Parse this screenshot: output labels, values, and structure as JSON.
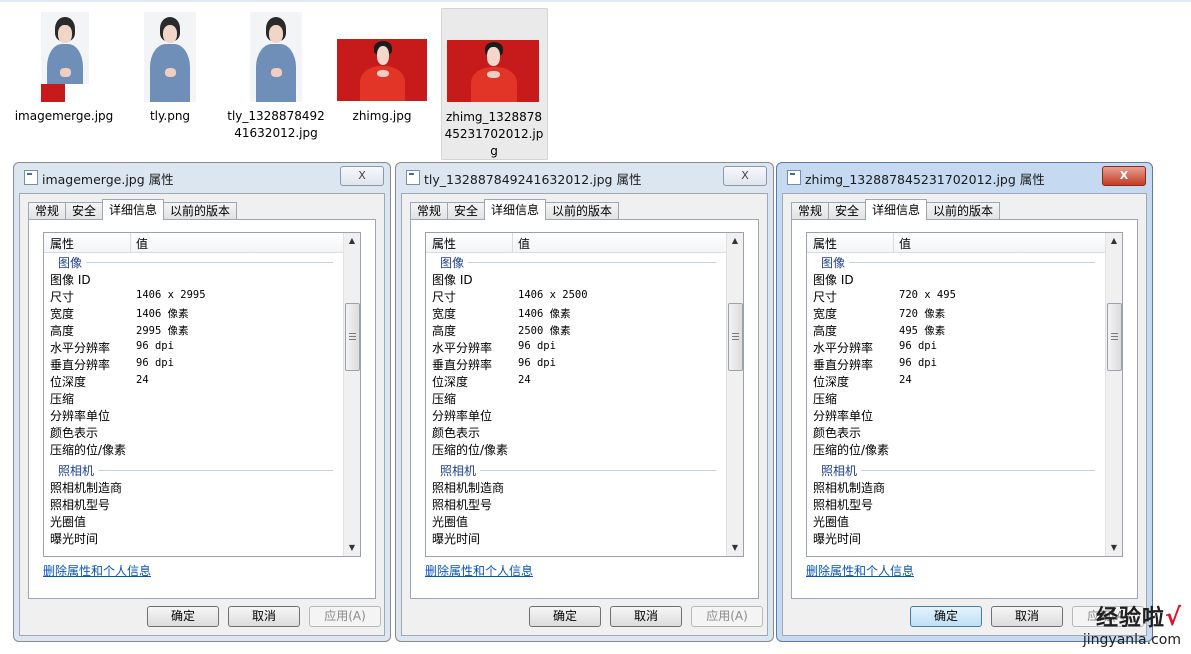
{
  "files": [
    {
      "name": "imagemerge.jpg",
      "kind": "portrait-merged"
    },
    {
      "name": "tly.png",
      "kind": "portrait"
    },
    {
      "name": "tly_132887849241632012.jpg",
      "kind": "portrait"
    },
    {
      "name": "zhimg.jpg",
      "kind": "red"
    },
    {
      "name": "zhimg_132887845231702012.jpg",
      "kind": "red",
      "selected": true
    }
  ],
  "common": {
    "close": "X",
    "tabs": [
      "常规",
      "安全",
      "详细信息",
      "以前的版本"
    ],
    "col_property": "属性",
    "col_value": "值",
    "group_image": "图像",
    "group_camera": "照相机",
    "link": "删除属性和个人信息",
    "ok": "确定",
    "cancel": "取消",
    "apply": "应用(A)"
  },
  "dialogs": [
    {
      "title": "imagemerge.jpg 属性",
      "image_rows": [
        {
          "k": "图像 ID",
          "v": ""
        },
        {
          "k": "尺寸",
          "v": "1406 x 2995"
        },
        {
          "k": "宽度",
          "v": "1406 像素"
        },
        {
          "k": "高度",
          "v": "2995 像素"
        },
        {
          "k": "水平分辨率",
          "v": "96 dpi"
        },
        {
          "k": "垂直分辨率",
          "v": "96 dpi"
        },
        {
          "k": "位深度",
          "v": "24"
        },
        {
          "k": "压缩",
          "v": ""
        },
        {
          "k": "分辨率单位",
          "v": ""
        },
        {
          "k": "颜色表示",
          "v": ""
        },
        {
          "k": "压缩的位/像素",
          "v": ""
        }
      ],
      "camera_rows": [
        {
          "k": "照相机制造商",
          "v": ""
        },
        {
          "k": "照相机型号",
          "v": ""
        },
        {
          "k": "光圈值",
          "v": ""
        },
        {
          "k": "曝光时间",
          "v": ""
        }
      ]
    },
    {
      "title": "tly_132887849241632012.jpg 属性",
      "image_rows": [
        {
          "k": "图像 ID",
          "v": ""
        },
        {
          "k": "尺寸",
          "v": "1406 x 2500"
        },
        {
          "k": "宽度",
          "v": "1406 像素"
        },
        {
          "k": "高度",
          "v": "2500 像素"
        },
        {
          "k": "水平分辨率",
          "v": "96 dpi"
        },
        {
          "k": "垂直分辨率",
          "v": "96 dpi"
        },
        {
          "k": "位深度",
          "v": "24"
        },
        {
          "k": "压缩",
          "v": ""
        },
        {
          "k": "分辨率单位",
          "v": ""
        },
        {
          "k": "颜色表示",
          "v": ""
        },
        {
          "k": "压缩的位/像素",
          "v": ""
        }
      ],
      "camera_rows": [
        {
          "k": "照相机制造商",
          "v": ""
        },
        {
          "k": "照相机型号",
          "v": ""
        },
        {
          "k": "光圈值",
          "v": ""
        },
        {
          "k": "曝光时间",
          "v": ""
        }
      ]
    },
    {
      "title": "zhimg_132887845231702012.jpg 属性",
      "active": true,
      "image_rows": [
        {
          "k": "图像 ID",
          "v": ""
        },
        {
          "k": "尺寸",
          "v": "720 x 495"
        },
        {
          "k": "宽度",
          "v": "720 像素"
        },
        {
          "k": "高度",
          "v": "495 像素"
        },
        {
          "k": "水平分辨率",
          "v": "96 dpi"
        },
        {
          "k": "垂直分辨率",
          "v": "96 dpi"
        },
        {
          "k": "位深度",
          "v": "24"
        },
        {
          "k": "压缩",
          "v": ""
        },
        {
          "k": "分辨率单位",
          "v": ""
        },
        {
          "k": "颜色表示",
          "v": ""
        },
        {
          "k": "压缩的位/像素",
          "v": ""
        }
      ],
      "camera_rows": [
        {
          "k": "照相机制造商",
          "v": ""
        },
        {
          "k": "照相机型号",
          "v": ""
        },
        {
          "k": "光圈值",
          "v": ""
        },
        {
          "k": "曝光时间",
          "v": ""
        }
      ]
    }
  ],
  "watermark": {
    "main": "经验啦",
    "check": "√",
    "url": "jingyanla.com"
  }
}
